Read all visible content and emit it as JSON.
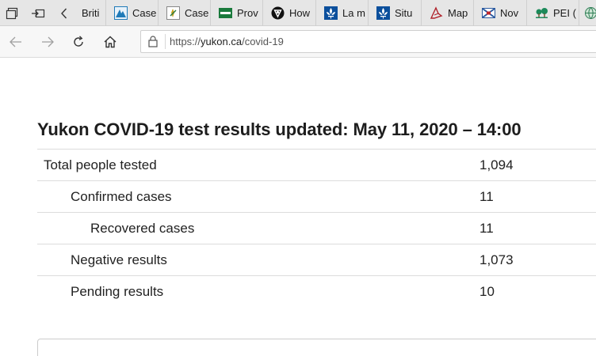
{
  "tabs": [
    {
      "title": "Briti",
      "icon": "none"
    },
    {
      "title": "Case",
      "icon": "alberta-icon",
      "color": "#1f7ab8"
    },
    {
      "title": "Case",
      "icon": "saskatchewan-icon",
      "color": "#c9a21e"
    },
    {
      "title": "Prov",
      "icon": "manitoba-icon",
      "color": "#1a7a3c"
    },
    {
      "title": "How",
      "icon": "ontario-trillium-icon",
      "color": "#111111"
    },
    {
      "title": "La m",
      "icon": "quebec-fleur-de-lis-icon",
      "color": "#0b4f9c"
    },
    {
      "title": "Situ",
      "icon": "quebec-fleur-de-lis-icon",
      "color": "#0b4f9c"
    },
    {
      "title": "Map",
      "icon": "new-brunswick-icon",
      "color": "#b0222b"
    },
    {
      "title": "Nov",
      "icon": "nova-scotia-icon",
      "color": "#2b5aa0"
    },
    {
      "title": "PEI (",
      "icon": "pei-icon",
      "color": "#1c8a5a"
    }
  ],
  "address_bar": {
    "url_prefix": "https://",
    "url_host": "yukon.ca",
    "url_path": "/covid-19"
  },
  "page": {
    "title": "Yukon COVID-19 test results updated: May 11, 2020 – 14:00",
    "rows": [
      {
        "label": "Total people tested",
        "value": "1,094"
      },
      {
        "label": "Confirmed cases",
        "value": "11"
      },
      {
        "label": "Recovered cases",
        "value": "11"
      },
      {
        "label": "Negative results",
        "value": "1,073"
      },
      {
        "label": "Pending results",
        "value": "10"
      }
    ]
  }
}
